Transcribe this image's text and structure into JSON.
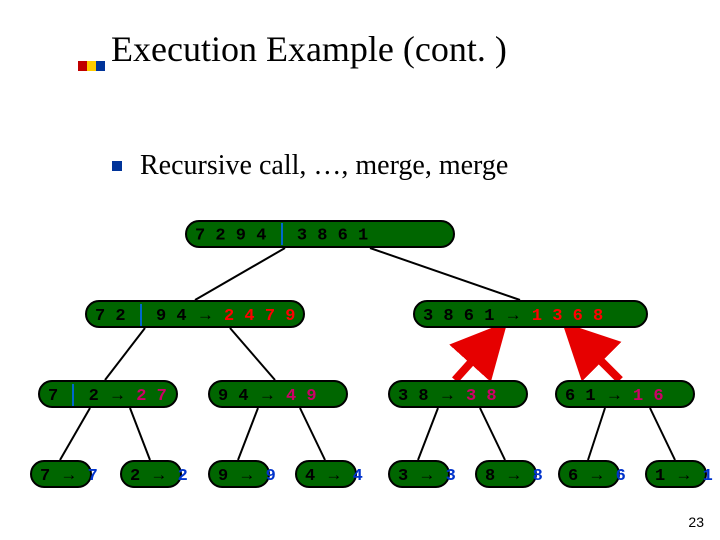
{
  "title": "Execution Example (cont. )",
  "bullet": "Recursive call, …, merge, merge",
  "page_number": "23",
  "tree": {
    "root": {
      "left": "7 2 9 4",
      "right": "3 8 6 1",
      "out": ""
    },
    "l": {
      "left": "7 2",
      "right": "9 4",
      "out": "2 4 7 9"
    },
    "r": {
      "in": "3 8 6 1",
      "out": "1 3 6 8"
    },
    "ll": {
      "left": "7",
      "right": "2",
      "out": "2 7"
    },
    "lr": {
      "in": "9 4",
      "out": "4 9"
    },
    "rl": {
      "in": "3 8",
      "out": "3 8"
    },
    "rr": {
      "in": "6 1",
      "out": "1 6"
    },
    "leaves": [
      {
        "in": "7",
        "out": "7"
      },
      {
        "in": "2",
        "out": "2"
      },
      {
        "in": "9",
        "out": "9"
      },
      {
        "in": "4",
        "out": "4"
      },
      {
        "in": "3",
        "out": "3"
      },
      {
        "in": "8",
        "out": "8"
      },
      {
        "in": "6",
        "out": "6"
      },
      {
        "in": "1",
        "out": "1"
      }
    ]
  },
  "arrow_glyph": "→",
  "chart_data": {
    "type": "tree",
    "description": "Merge-sort recursion tree showing input halves and merged output at each node",
    "levels": [
      {
        "depth": 0,
        "nodes": [
          {
            "input": [
              7,
              2,
              9,
              4,
              3,
              8,
              6,
              1
            ],
            "output": null,
            "split_after": 4
          }
        ]
      },
      {
        "depth": 1,
        "nodes": [
          {
            "input": [
              7,
              2,
              9,
              4
            ],
            "output": [
              2,
              4,
              7,
              9
            ],
            "split_after": 2
          },
          {
            "input": [
              3,
              8,
              6,
              1
            ],
            "output": [
              1,
              3,
              6,
              8
            ]
          }
        ]
      },
      {
        "depth": 2,
        "nodes": [
          {
            "input": [
              7,
              2
            ],
            "output": [
              2,
              7
            ],
            "split_after": 1
          },
          {
            "input": [
              9,
              4
            ],
            "output": [
              4,
              9
            ]
          },
          {
            "input": [
              3,
              8
            ],
            "output": [
              3,
              8
            ]
          },
          {
            "input": [
              6,
              1
            ],
            "output": [
              1,
              6
            ]
          }
        ]
      },
      {
        "depth": 3,
        "nodes": [
          {
            "input": [
              7
            ],
            "output": [
              7
            ]
          },
          {
            "input": [
              2
            ],
            "output": [
              2
            ]
          },
          {
            "input": [
              9
            ],
            "output": [
              9
            ]
          },
          {
            "input": [
              4
            ],
            "output": [
              4
            ]
          },
          {
            "input": [
              3
            ],
            "output": [
              3
            ]
          },
          {
            "input": [
              8
            ],
            "output": [
              8
            ]
          },
          {
            "input": [
              6
            ],
            "output": [
              6
            ]
          },
          {
            "input": [
              1
            ],
            "output": [
              1
            ]
          }
        ]
      }
    ],
    "highlighted_merge_edges": [
      {
        "from": "depth2[2]",
        "to": "depth1[1]"
      },
      {
        "from": "depth2[3]",
        "to": "depth1[1]"
      }
    ]
  }
}
